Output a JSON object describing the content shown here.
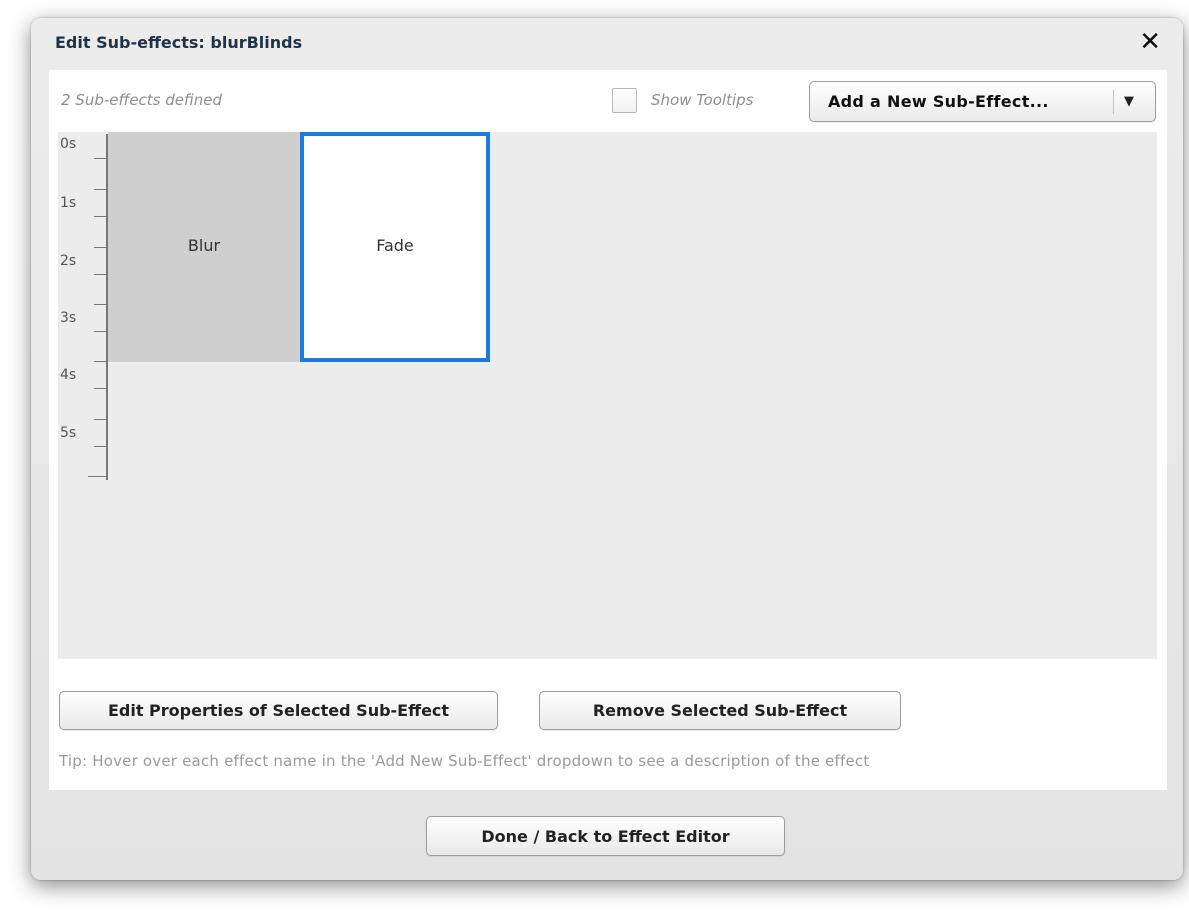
{
  "dialog": {
    "title": "Edit Sub-effects: blurBlinds",
    "close_label": "✕"
  },
  "toolbar": {
    "count_label": "2 Sub-effects defined",
    "show_tooltips_label": "Show Tooltips",
    "show_tooltips_checked": false,
    "add_select_label": "Add a New Sub-Effect...",
    "add_select_arrow": "▼"
  },
  "timeline": {
    "ticks": [
      "0s",
      "1s",
      "2s",
      "3s",
      "4s",
      "5s"
    ],
    "sub_effects": [
      {
        "name": "Blur",
        "selected": false,
        "color": "#cfcfcf"
      },
      {
        "name": "Fade",
        "selected": true,
        "color": "#ffffff",
        "selected_border": "#1a7be3"
      }
    ]
  },
  "actions": {
    "edit_label": "Edit Properties of Selected Sub-Effect",
    "remove_label": "Remove Selected Sub-Effect",
    "tip": "Tip: Hover over each effect name in the 'Add New Sub-Effect' dropdown to see a description of the effect"
  },
  "footer": {
    "done_label": "Done / Back to Effect Editor"
  }
}
